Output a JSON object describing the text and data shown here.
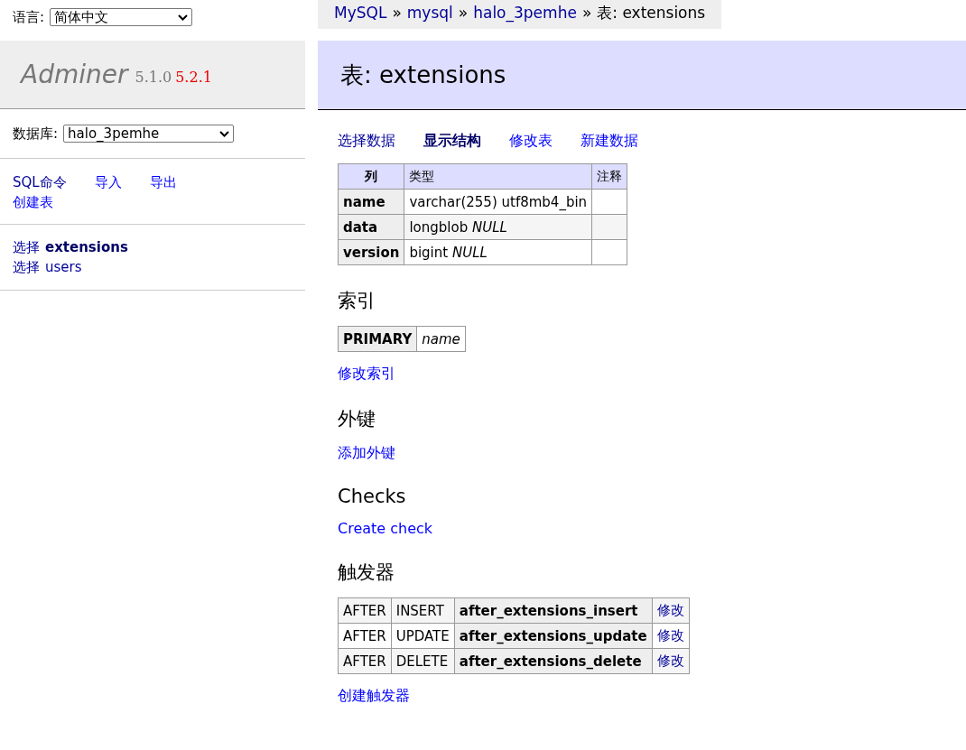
{
  "language": {
    "label": "语言:",
    "value": "简体中文"
  },
  "logo": {
    "name": "Adminer",
    "version": "5.1.0",
    "new_version": "5.2.1"
  },
  "database": {
    "label": "数据库:",
    "value": "halo_3pemhe"
  },
  "sidebar_links": [
    {
      "label": "SQL命令",
      "visited": true
    },
    {
      "label": "导入",
      "visited": false
    },
    {
      "label": "导出",
      "visited": false
    },
    {
      "label": "创建表",
      "visited": false
    }
  ],
  "tables": [
    {
      "action": "选择",
      "name": "extensions",
      "selected": true
    },
    {
      "action": "选择",
      "name": "users",
      "selected": false
    }
  ],
  "breadcrumb": {
    "links": [
      "MySQL",
      "mysql",
      "halo_3pemhe"
    ],
    "separator": "»",
    "current": "表: extensions"
  },
  "title": "表: extensions",
  "tabs": [
    {
      "label": "选择数据",
      "selected": false,
      "visited": true
    },
    {
      "label": "显示结构",
      "selected": true,
      "visited": true
    },
    {
      "label": "修改表",
      "selected": false,
      "visited": false
    },
    {
      "label": "新建数据",
      "selected": false,
      "visited": false
    }
  ],
  "structure": {
    "columns": [
      "列",
      "类型",
      "注释"
    ],
    "rows": [
      {
        "name": "name",
        "type": "varchar(255) utf8mb4_bin",
        "comment": ""
      },
      {
        "name": "data",
        "type": "longblob *NULL*",
        "comment": ""
      },
      {
        "name": "version",
        "type": "bigint *NULL*",
        "comment": ""
      }
    ]
  },
  "indexes": {
    "heading": "索引",
    "rows": [
      {
        "type": "PRIMARY",
        "columns": "name"
      }
    ],
    "link": "修改索引"
  },
  "foreign_keys": {
    "heading": "外键",
    "link": "添加外键"
  },
  "checks": {
    "heading": "Checks",
    "link": "Create check"
  },
  "triggers": {
    "heading": "触发器",
    "rows": [
      {
        "timing": "AFTER",
        "event": "INSERT",
        "name": "after_extensions_insert",
        "action": "修改"
      },
      {
        "timing": "AFTER",
        "event": "UPDATE",
        "name": "after_extensions_update",
        "action": "修改"
      },
      {
        "timing": "AFTER",
        "event": "DELETE",
        "name": "after_extensions_delete",
        "action": "修改"
      }
    ],
    "link": "创建触发器"
  }
}
